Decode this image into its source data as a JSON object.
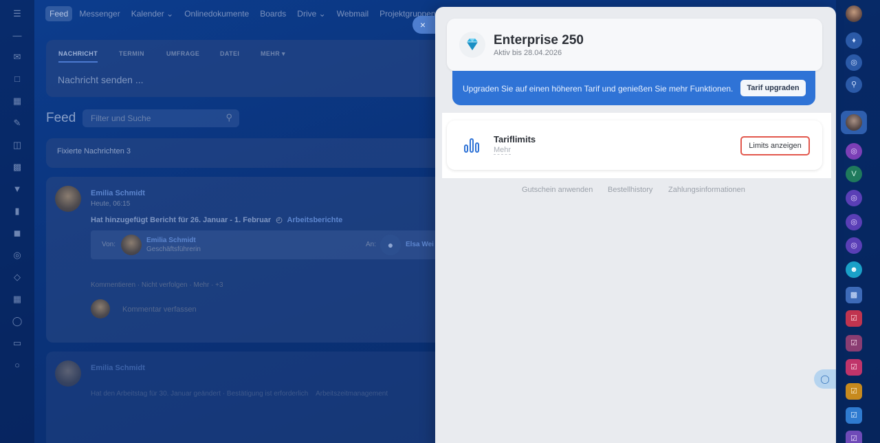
{
  "nav": {
    "items": [
      "Feed",
      "Messenger",
      "Kalender",
      "Onlinedokumente",
      "Boards",
      "Drive",
      "Webmail",
      "Projektgruppen"
    ],
    "active": "Feed"
  },
  "composer": {
    "tabs": [
      "NACHRICHT",
      "TERMIN",
      "UMFRAGE",
      "DATEI",
      "MEHR"
    ],
    "placeholder": "Nachricht senden ..."
  },
  "feed": {
    "heading": "Feed",
    "filter_placeholder": "Filter und Suche",
    "pinned": "Fixierte Nachrichten 3",
    "post1": {
      "author": "Emilia Schmidt",
      "time": "Heute, 06:15",
      "action": "Hat hinzugefügt Bericht für 26. Januar - 1. Februar",
      "tag": "Arbeitsberichte",
      "from_label": "Von:",
      "from_name": "Emilia Schmidt",
      "from_role": "Geschäftsführerin",
      "to_label": "An:",
      "to_name": "Elsa Wei",
      "actions": "Kommentieren · Nicht verfolgen · Mehr · +3",
      "comment_placeholder": "Kommentar verfassen"
    },
    "post2": {
      "author": "Emilia Schmidt",
      "action": "Hat den Arbeitstag für 30. Januar geändert · Bestätigung ist erforderlich",
      "tag": "Arbeitszeitmanagement"
    }
  },
  "panel": {
    "close": "×",
    "plan_name": "Enterprise 250",
    "plan_sub": "Aktiv bis 28.04.2026",
    "upgrade_text": "Upgraden Sie auf einen höheren Tarif und genießen Sie mehr Funktionen.",
    "upgrade_button": "Tarif upgraden",
    "limits_title": "Tariflimits",
    "limits_more": "Mehr",
    "limits_button": "Limits anzeigen",
    "footer_links": [
      "Gutschein anwenden",
      "Bestellhistory",
      "Zahlungsinformationen"
    ]
  },
  "right_rail": {
    "letter_v": "V"
  },
  "colors": {
    "accent": "#2f73d6",
    "highlight_border": "#e2574c",
    "panel_bg": "#e9ebef"
  }
}
